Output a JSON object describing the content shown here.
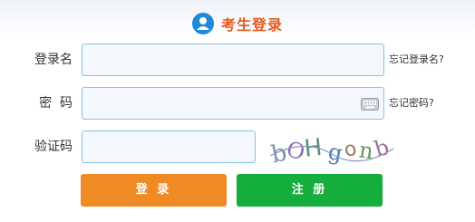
{
  "header": {
    "title": "考生登录",
    "icon": "user-avatar-icon",
    "icon_color": "#1e88d9",
    "title_color": "#e8571e"
  },
  "form": {
    "username": {
      "label": "登录名",
      "value": "",
      "forgot_link": "忘记登录名?"
    },
    "password": {
      "label": "密  码",
      "value": "",
      "forgot_link": "忘记密码?",
      "keyboard_icon": "virtual-keyboard-icon"
    },
    "captcha": {
      "label": "验证码",
      "value": "",
      "captcha_text": "bOHgonb"
    }
  },
  "buttons": {
    "login_label": "登 录",
    "login_color": "#f08a24",
    "register_label": "注 册",
    "register_color": "#15ad3b"
  }
}
